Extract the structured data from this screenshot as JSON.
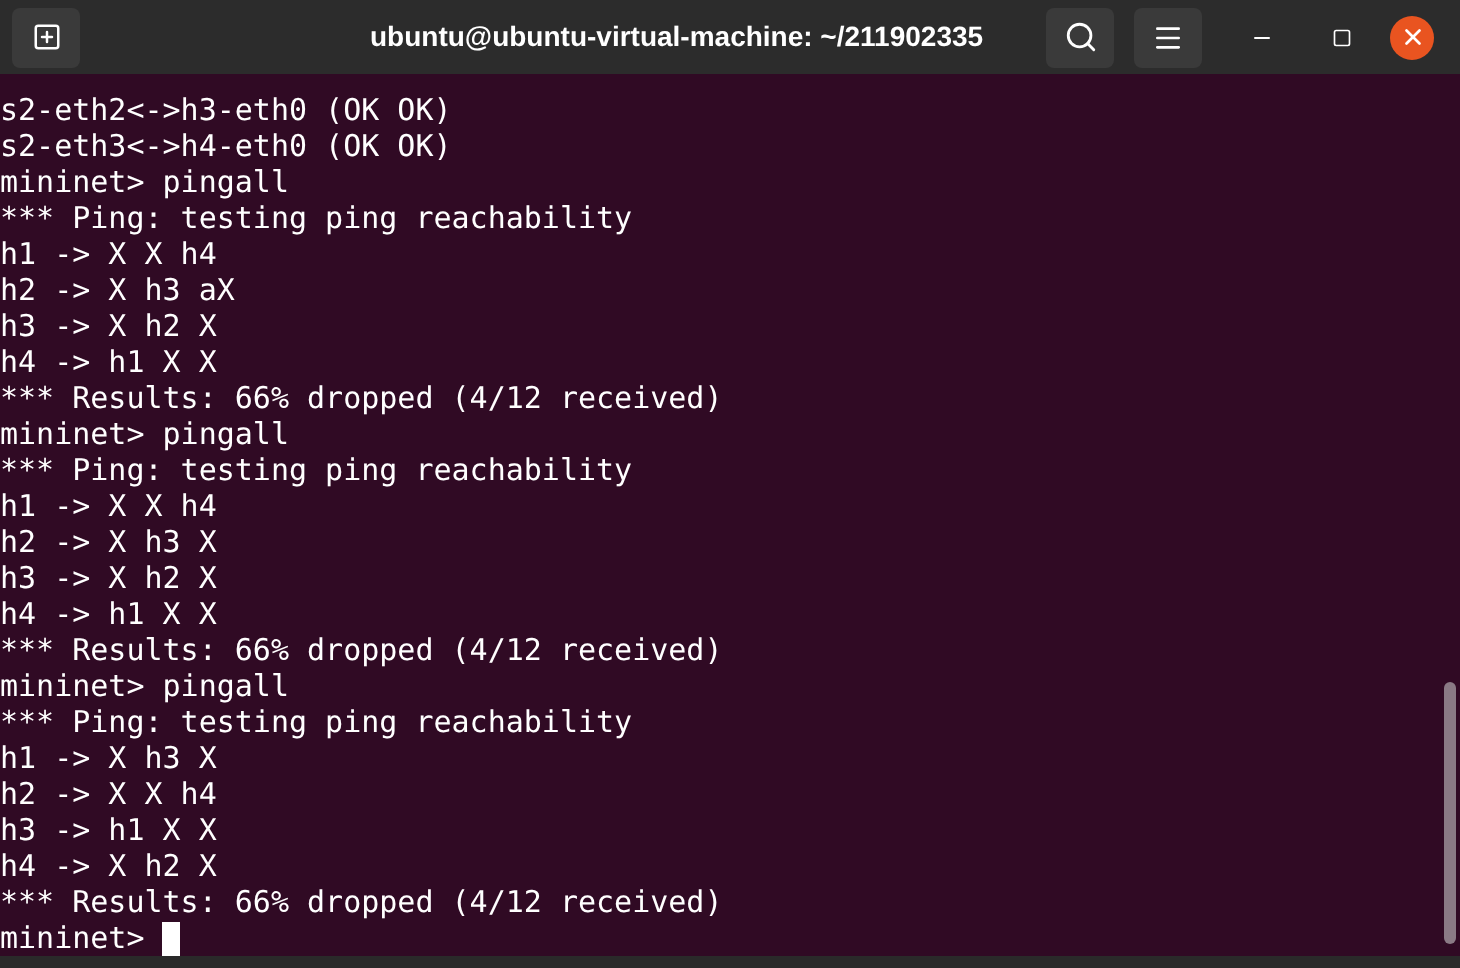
{
  "window": {
    "title": "ubuntu@ubuntu-virtual-machine: ~/211902335"
  },
  "terminal": {
    "lines": [
      "s2-eth2<->h3-eth0 (OK OK)",
      "s2-eth3<->h4-eth0 (OK OK)",
      "mininet> pingall",
      "*** Ping: testing ping reachability",
      "h1 -> X X h4",
      "h2 -> X h3 aX",
      "h3 -> X h2 X",
      "h4 -> h1 X X",
      "*** Results: 66% dropped (4/12 received)",
      "mininet> pingall",
      "*** Ping: testing ping reachability",
      "h1 -> X X h4",
      "h2 -> X h3 X",
      "h3 -> X h2 X",
      "h4 -> h1 X X",
      "*** Results: 66% dropped (4/12 received)",
      "mininet> pingall",
      "*** Ping: testing ping reachability",
      "h1 -> X h3 X",
      "h2 -> X X h4",
      "h3 -> h1 X X",
      "h4 -> X h2 X",
      "*** Results: 66% dropped (4/12 received)"
    ],
    "prompt": "mininet>"
  }
}
